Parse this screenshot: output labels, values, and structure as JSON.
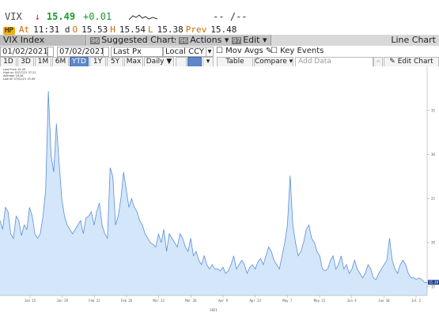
{
  "quote": {
    "ticker": "VIX",
    "direction_arrow": "↓",
    "last": "15.49",
    "change": "+0.01",
    "placeholder": "-- /--",
    "fn_label": "HP",
    "at_label": "At",
    "time": "11:31 d",
    "open_label": "O",
    "open": "15.53",
    "high_label": "H",
    "high": "15.54",
    "low_label": "L",
    "low": "15.38",
    "prev_label": "Prev",
    "prev": "15.48"
  },
  "menubar": {
    "security": "VIX Index",
    "suggested_num": "96",
    "suggested": "Suggested Charts",
    "actions_num": "96",
    "actions": "Actions ▾",
    "edit_num": "97",
    "edit": "Edit ▾",
    "title": "Line Chart"
  },
  "toolbar": {
    "start_date": "01/02/2021",
    "end_date": "07/02/2021",
    "field": "Last Px",
    "currency": "Local CCY",
    "mov_avgs": "Mov Avgs",
    "key_events": "Key Events",
    "table": "Table",
    "compare": "Compare ▾",
    "add_data_placeholder": "Add Data",
    "edit_chart": "Edit Chart"
  },
  "timebar": {
    "ranges": [
      "1D",
      "3D",
      "1M",
      "6M",
      "YTD",
      "1Y",
      "5Y",
      "Max"
    ],
    "active": "YTD",
    "frequency": "Daily ▼"
  },
  "legend": {
    "items": [
      "Last Price  15.49",
      "High on 01/27/21  37.21",
      "Average  18.46",
      "Low on 07/02/21  15.49"
    ]
  },
  "colors": {
    "line": "#5a8fd6",
    "fill": "#d4e6fa",
    "last_price": "#1a9a2c",
    "down_arrow": "#d23",
    "active_tab": "#5f87c7"
  },
  "chart_data": {
    "type": "area",
    "series": [
      {
        "name": "Last Price",
        "values": [
          22.5,
          21.5,
          24.0,
          23.5,
          21.0,
          20.5,
          23.0,
          22.5,
          20.8,
          22.0,
          21.5,
          24.0,
          23.0,
          21.0,
          20.5,
          21.0,
          23.0,
          26.0,
          37.2,
          30.0,
          28.0,
          33.5,
          29.0,
          25.0,
          23.0,
          22.0,
          21.5,
          21.0,
          21.5,
          22.0,
          22.5,
          21.0,
          22.8,
          23.0,
          23.5,
          22.0,
          23.5,
          24.5,
          22.0,
          21.0,
          20.5,
          28.5,
          27.5,
          22.0,
          23.0,
          25.0,
          28.0,
          26.0,
          24.0,
          25.0,
          24.0,
          23.5,
          22.5,
          22.0,
          21.0,
          20.5,
          20.0,
          19.8,
          19.5,
          21.0,
          20.0,
          21.5,
          19.0,
          21.0,
          20.5,
          20.0,
          19.5,
          21.0,
          20.5,
          19.5,
          19.0,
          20.5,
          18.5,
          19.0,
          18.0,
          17.5,
          18.5,
          17.5,
          17.0,
          17.5,
          17.0,
          17.0,
          16.8,
          17.2,
          16.5,
          16.8,
          17.5,
          18.5,
          17.0,
          17.5,
          18.0,
          17.5,
          16.5,
          17.2,
          17.5,
          17.0,
          17.8,
          18.2,
          17.5,
          18.5,
          19.5,
          19.0,
          18.0,
          17.5,
          17.0,
          18.5,
          20.0,
          22.0,
          27.6,
          22.0,
          20.0,
          18.5,
          19.0,
          20.0,
          21.5,
          22.0,
          20.5,
          20.0,
          19.0,
          18.5,
          17.0,
          16.8,
          17.0,
          18.0,
          18.5,
          17.0,
          17.5,
          18.5,
          17.0,
          17.5,
          16.5,
          17.0,
          18.0,
          17.0,
          16.5,
          16.0,
          16.5,
          17.5,
          17.0,
          16.0,
          15.8,
          16.5,
          17.0,
          17.5,
          18.0,
          20.5,
          18.0,
          17.0,
          16.5,
          17.5,
          18.0,
          17.5,
          16.5,
          16.0,
          16.0,
          15.8,
          16.0,
          15.8,
          15.5,
          15.49
        ]
      }
    ],
    "x_tick_labels": [
      "Jan 15",
      "Jan 29",
      "Feb 12",
      "Feb 26",
      "Mar 12",
      "Mar 26",
      "Apr 9",
      "Apr 23",
      "May 7",
      "May 21",
      "Jun 4",
      "Jun 18",
      "Jul 2"
    ],
    "x_axis_label": "2021",
    "y_tick_labels": [
      "35",
      "30",
      "25",
      "20",
      "15"
    ],
    "ylim": [
      14,
      40
    ],
    "grid": false,
    "legend_position": "top-left"
  }
}
